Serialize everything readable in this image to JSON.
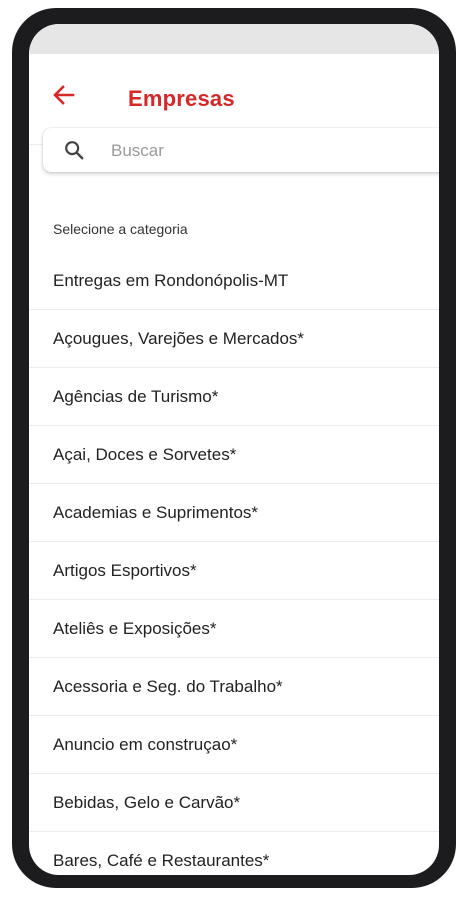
{
  "header": {
    "title": "Empresas",
    "back_icon": "arrow-left-icon",
    "accent_color": "#d62828"
  },
  "search": {
    "placeholder": "Buscar",
    "icon": "search-icon"
  },
  "section": {
    "label": "Selecione a categoria"
  },
  "categories": [
    "Entregas em Rondonópolis-MT",
    "Açougues, Varejões e Mercados*",
    "Agências de Turismo*",
    "Açai, Doces e Sorvetes*",
    "Academias e Suprimentos*",
    "Artigos Esportivos*",
    "Ateliês e Exposições*",
    "Acessoria e Seg. do Trabalho*",
    "Anuncio em construçao*",
    "Bebidas, Gelo e Carvão*",
    "Bares, Café e Restaurantes*"
  ]
}
